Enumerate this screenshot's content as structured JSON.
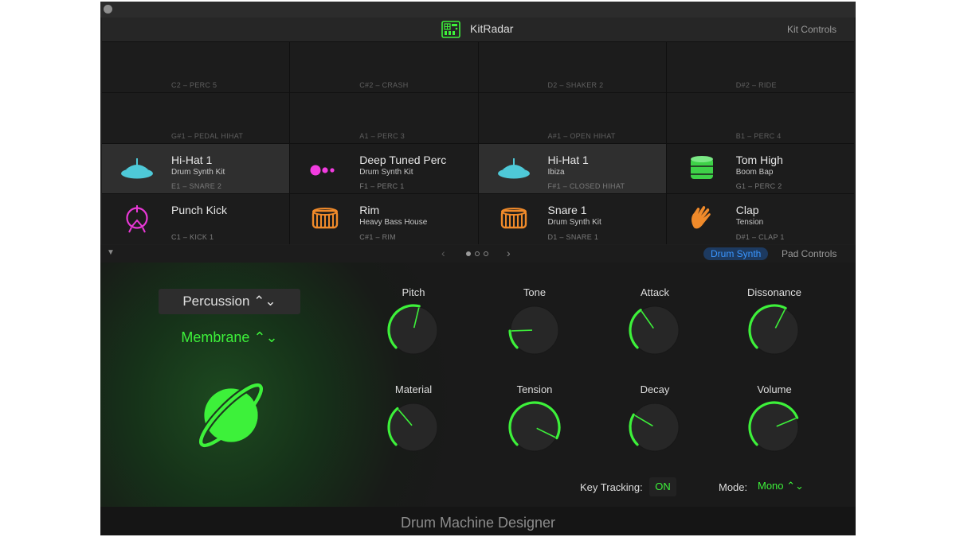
{
  "app": {
    "title": "KitRadar",
    "kit_controls_label": "Kit Controls",
    "footer_title": "Drum Machine Designer"
  },
  "colors": {
    "accent": "#3df13a",
    "tab_active_text": "#3a96ff",
    "tab_active_bg": "#1d3a60",
    "background": "#1e1e1e"
  },
  "pads": [
    {
      "note": "C2 – PERC 5"
    },
    {
      "note": "C#2 – CRASH"
    },
    {
      "note": "D2 – SHAKER 2"
    },
    {
      "note": "D#2 – RIDE"
    },
    {
      "note": "G#1 – PEDAL HIHAT"
    },
    {
      "note": "A1 – PERC 3"
    },
    {
      "note": "A#1 – OPEN HIHAT"
    },
    {
      "note": "B1 – PERC 4"
    },
    {
      "name": "Hi-Hat 1",
      "sub": "Drum Synth Kit",
      "note": "E1 – SNARE 2",
      "icon": "hihat-icon",
      "color": "#4ec9d8",
      "selected": true
    },
    {
      "name": "Deep Tuned Perc",
      "sub": "Drum Synth Kit",
      "note": "F1 – PERC 1",
      "icon": "perc-dots-icon",
      "color": "#f23ce0",
      "selected": false
    },
    {
      "name": "Hi-Hat 1",
      "sub": "Ibiza",
      "note": "F#1 – CLOSED HIHAT",
      "icon": "hihat-icon",
      "color": "#4ec9d8",
      "selected": true
    },
    {
      "name": "Tom High",
      "sub": "Boom Bap",
      "note": "G1 – PERC 2",
      "icon": "tom-drum-icon",
      "color": "#3ed148",
      "selected": false
    },
    {
      "name": "Punch Kick",
      "sub": "",
      "note": "C1 – KICK 1",
      "icon": "kick-drum-icon",
      "color": "#e838d6",
      "selected": false
    },
    {
      "name": "Rim",
      "sub": "Heavy Bass House",
      "note": "C#1 – RIM",
      "icon": "snare-drum-icon",
      "color": "#f08a2a",
      "selected": false
    },
    {
      "name": "Snare 1",
      "sub": "Drum Synth Kit",
      "note": "D1 – SNARE 1",
      "icon": "snare-drum-icon",
      "color": "#f08a2a",
      "selected": false
    },
    {
      "name": "Clap",
      "sub": "Tension",
      "note": "D#1 – CLAP 1",
      "icon": "clap-hand-icon",
      "color": "#f08a2a",
      "selected": false
    }
  ],
  "nav": {
    "prev": "‹",
    "next": "›",
    "page_dots": 3,
    "active_page": 0,
    "collapse": "▼"
  },
  "tabs": {
    "drum_synth": "Drum Synth",
    "pad_controls": "Pad Controls",
    "active": "drum_synth"
  },
  "synth": {
    "category": "Percussion ⌃⌄",
    "model": "Membrane ⌃⌄",
    "knobs": [
      {
        "label": "Pitch",
        "value": 0.55
      },
      {
        "label": "Tone",
        "value": 0.16
      },
      {
        "label": "Attack",
        "value": 0.37
      },
      {
        "label": "Dissonance",
        "value": 0.6
      },
      {
        "label": "Material",
        "value": 0.35
      },
      {
        "label": "Tension",
        "value": 0.93
      },
      {
        "label": "Decay",
        "value": 0.28
      },
      {
        "label": "Volume",
        "value": 0.75
      }
    ],
    "key_tracking": {
      "label": "Key Tracking:",
      "value": "ON"
    },
    "mode": {
      "label": "Mode:",
      "value": "Mono ⌃⌄"
    }
  }
}
